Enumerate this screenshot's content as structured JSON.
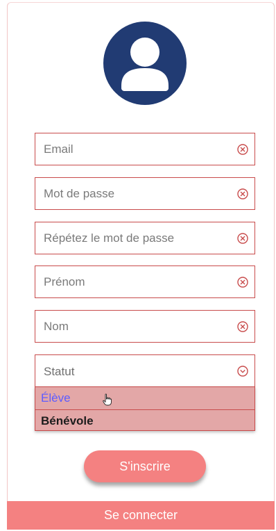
{
  "avatar": {
    "icon": "user-avatar-icon",
    "color": "#213b73"
  },
  "form": {
    "email": {
      "placeholder": "Email",
      "value": ""
    },
    "password": {
      "placeholder": "Mot de passe",
      "value": ""
    },
    "password_confirm": {
      "placeholder": "Répétez le mot de passe",
      "value": ""
    },
    "first_name": {
      "placeholder": "Prénom",
      "value": ""
    },
    "last_name": {
      "placeholder": "Nom",
      "value": ""
    },
    "status": {
      "label": "Statut",
      "options": [
        "Élève",
        "Bénévole"
      ]
    }
  },
  "buttons": {
    "signup": "S'inscrire",
    "login": "Se connecter"
  },
  "colors": {
    "accent": "#f48181",
    "field_border": "#c84b4b",
    "dropdown_bg": "#e3a7a7",
    "option_hover_text": "#5d5cff"
  }
}
